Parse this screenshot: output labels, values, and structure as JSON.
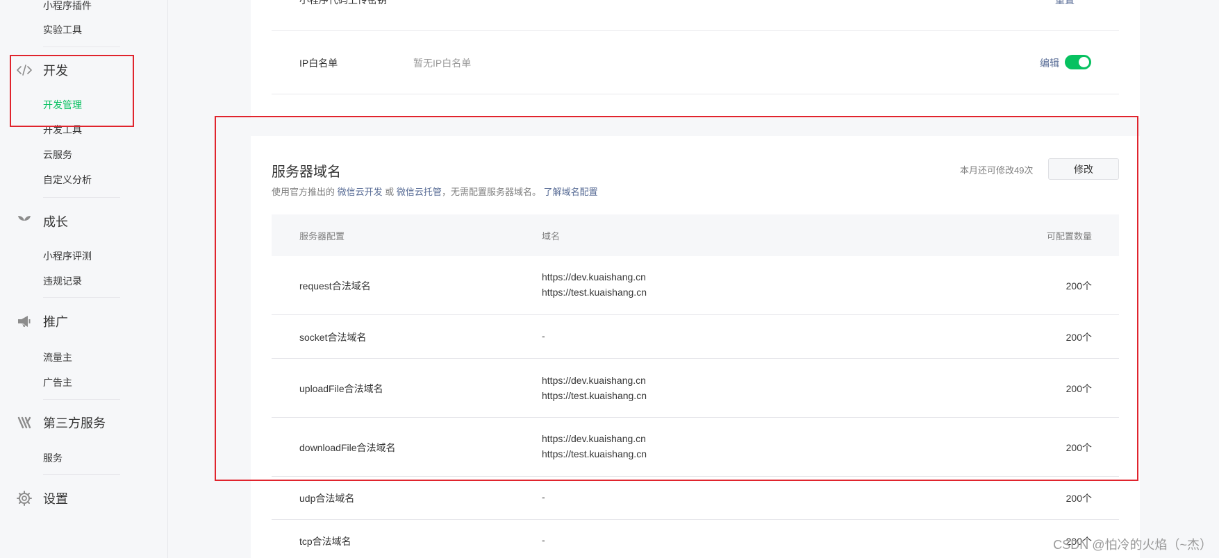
{
  "sidebar": {
    "top_items": [
      "小程序插件",
      "实验工具"
    ],
    "groups": [
      {
        "icon": "code-icon",
        "title": "开发",
        "items": [
          "开发管理",
          "开发工具",
          "云服务",
          "自定义分析"
        ]
      },
      {
        "icon": "sprout-icon",
        "title": "成长",
        "items": [
          "小程序评测",
          "违规记录"
        ]
      },
      {
        "icon": "megaphone-icon",
        "title": "推广",
        "items": [
          "流量主",
          "广告主"
        ]
      },
      {
        "icon": "third-party-icon",
        "title": "第三方服务",
        "items": [
          "服务"
        ]
      },
      {
        "icon": "gear-icon",
        "title": "设置",
        "items": []
      }
    ],
    "active_item": "开发管理"
  },
  "top_section": {
    "cut_label": "小程序代码上传密钥",
    "cut_action": "重置",
    "ip_whitelist_label": "IP白名单",
    "ip_whitelist_value": "暂无IP白名单",
    "ip_whitelist_edit": "编辑",
    "ip_whitelist_enabled": true
  },
  "server_domain": {
    "title": "服务器域名",
    "desc_prefix": "使用官方推出的",
    "desc_link1": "微信云开发",
    "desc_or": "或",
    "desc_link2": "微信云托管",
    "desc_suffix": "，无需配置服务器域名。",
    "desc_link3": "了解域名配置",
    "quota_text": "本月还可修改49次",
    "modify_button": "修改",
    "columns": [
      "服务器配置",
      "域名",
      "可配置数量"
    ],
    "rows": [
      {
        "name": "request合法域名",
        "domains": [
          "https://dev.kuaishang.cn",
          "https://test.kuaishang.cn"
        ],
        "count": "200个"
      },
      {
        "name": "socket合法域名",
        "domains": [
          "-"
        ],
        "count": "200个"
      },
      {
        "name": "uploadFile合法域名",
        "domains": [
          "https://dev.kuaishang.cn",
          "https://test.kuaishang.cn"
        ],
        "count": "200个"
      },
      {
        "name": "downloadFile合法域名",
        "domains": [
          "https://dev.kuaishang.cn",
          "https://test.kuaishang.cn"
        ],
        "count": "200个"
      },
      {
        "name": "udp合法域名",
        "domains": [
          "-"
        ],
        "count": "200个"
      },
      {
        "name": "tcp合法域名",
        "domains": [
          "-"
        ],
        "count": "200个"
      }
    ]
  },
  "colors": {
    "accent_green": "#07c160",
    "link_blue": "#576b95",
    "highlight_red": "#e0242d"
  },
  "watermark": "CSDN @怕冷的火焰（~杰）"
}
